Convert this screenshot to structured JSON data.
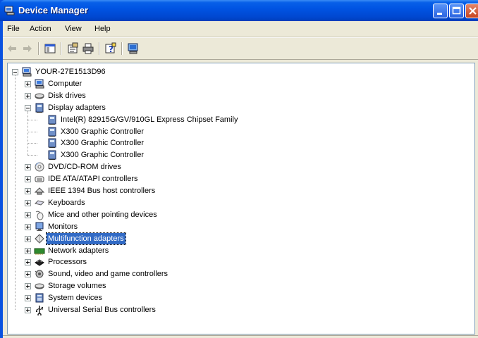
{
  "window": {
    "title": "Device Manager"
  },
  "menu": [
    {
      "key": "file",
      "label": "File"
    },
    {
      "key": "action",
      "label": "Action"
    },
    {
      "key": "view",
      "label": "View"
    },
    {
      "key": "help",
      "label": "Help"
    }
  ],
  "toolbar": {
    "buttons": [
      "back-arrow-icon",
      "forward-arrow-icon",
      "show-hide-console-tree-icon",
      "properties-icon",
      "print-icon",
      "help-icon",
      "scan-hardware-icon"
    ]
  },
  "tree": {
    "root": {
      "label": "YOUR-27E1513D96",
      "icon": "computer-icon"
    },
    "categories": [
      {
        "label": "Computer",
        "icon": "computer-icon"
      },
      {
        "label": "Disk drives",
        "icon": "disk-drive-icon"
      },
      {
        "label": "Display adapters",
        "icon": "display-adapter-icon",
        "expanded": true,
        "children": [
          "Intel(R) 82915G/GV/910GL Express Chipset Family",
          "X300 Graphic Controller",
          "X300 Graphic Controller",
          "X300 Graphic Controller"
        ]
      },
      {
        "label": "DVD/CD-ROM drives",
        "icon": "cdrom-icon"
      },
      {
        "label": "IDE ATA/ATAPI controllers",
        "icon": "ide-controller-icon"
      },
      {
        "label": "IEEE 1394 Bus host controllers",
        "icon": "firewire-icon"
      },
      {
        "label": "Keyboards",
        "icon": "keyboard-icon"
      },
      {
        "label": "Mice and other pointing devices",
        "icon": "mouse-icon"
      },
      {
        "label": "Monitors",
        "icon": "monitor-icon"
      },
      {
        "label": "Multifunction adapters",
        "icon": "multifunction-icon",
        "selected": true
      },
      {
        "label": "Network adapters",
        "icon": "network-adapter-icon"
      },
      {
        "label": "Processors",
        "icon": "processor-icon"
      },
      {
        "label": "Sound, video and game controllers",
        "icon": "sound-icon"
      },
      {
        "label": "Storage volumes",
        "icon": "storage-volume-icon"
      },
      {
        "label": "System devices",
        "icon": "system-devices-icon"
      },
      {
        "label": "Universal Serial Bus controllers",
        "icon": "usb-icon"
      }
    ]
  },
  "colors": {
    "titlebar": "#0054e3",
    "selection": "#316ac5",
    "chrome": "#ece9d8"
  }
}
